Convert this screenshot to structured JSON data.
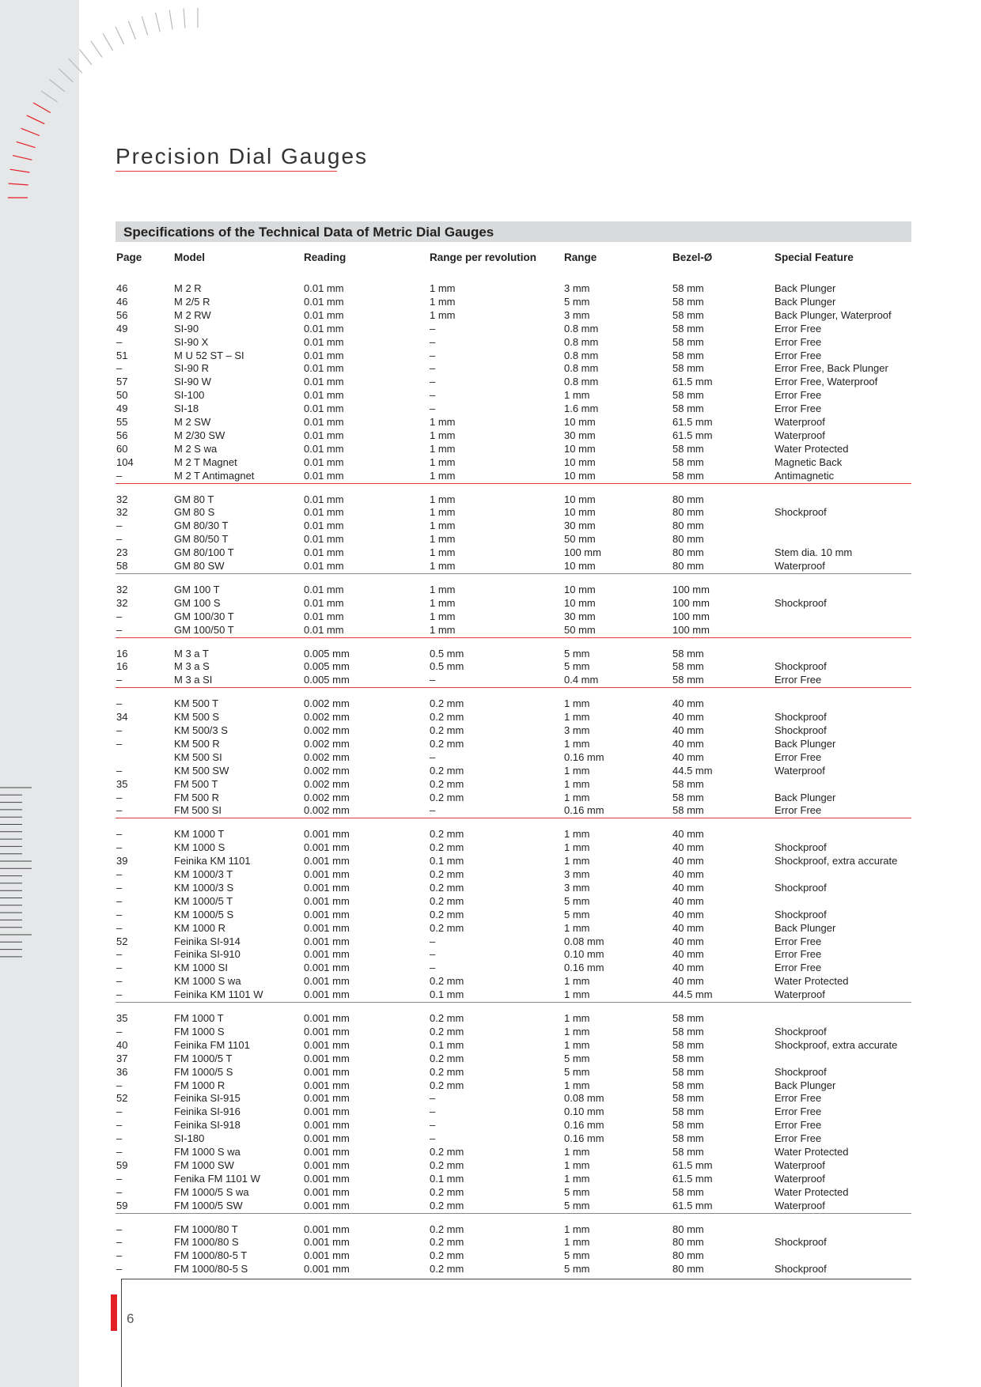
{
  "title": "Precision Dial Gauges",
  "section_title": "Specifications of the Technical Data of Metric Dial Gauges",
  "colors": {
    "accent_red": "#e31e24",
    "header_band": "#d9dadc",
    "left_strip": "#e6e7e9"
  },
  "columns": [
    "Page",
    "Model",
    "Reading",
    "Range per revolution",
    "Range",
    "Bezel-Ø",
    "Special Feature"
  ],
  "groups": [
    {
      "rule": "red",
      "rows": [
        [
          "46",
          "M 2 R",
          "0.01 mm",
          "1 mm",
          "3 mm",
          "58 mm",
          "Back Plunger"
        ],
        [
          "46",
          "M 2/5 R",
          "0.01 mm",
          "1 mm",
          "5 mm",
          "58 mm",
          "Back Plunger"
        ],
        [
          "56",
          "M 2 RW",
          "0.01 mm",
          "1 mm",
          "3 mm",
          "58 mm",
          "Back Plunger, Waterproof"
        ],
        [
          "49",
          "SI-90",
          "0.01 mm",
          "–",
          "0.8 mm",
          "58 mm",
          "Error Free"
        ],
        [
          "–",
          "SI-90 X",
          "0.01 mm",
          "–",
          "0.8 mm",
          "58 mm",
          "Error Free"
        ],
        [
          "51",
          "M U 52 ST – SI",
          "0.01 mm",
          "–",
          "0.8 mm",
          "58 mm",
          "Error Free"
        ],
        [
          "–",
          "SI-90 R",
          "0.01 mm",
          "–",
          "0.8 mm",
          "58 mm",
          "Error Free, Back Plunger"
        ],
        [
          "57",
          "SI-90 W",
          "0.01 mm",
          "–",
          "0.8 mm",
          "61.5 mm",
          "Error Free, Waterproof"
        ],
        [
          "50",
          "SI-100",
          "0.01 mm",
          "–",
          "1 mm",
          "58 mm",
          "Error Free"
        ],
        [
          "49",
          "SI-18",
          "0.01 mm",
          "–",
          "1.6 mm",
          "58 mm",
          "Error Free"
        ],
        [
          "55",
          "M 2 SW",
          "0.01 mm",
          "1 mm",
          "10 mm",
          "61.5 mm",
          "Waterproof"
        ],
        [
          "56",
          "M 2/30 SW",
          "0.01 mm",
          "1 mm",
          "30 mm",
          "61.5 mm",
          "Waterproof"
        ],
        [
          "60",
          "M 2 S wa",
          "0.01 mm",
          "1 mm",
          "10 mm",
          "58 mm",
          "Water Protected"
        ],
        [
          "104",
          "M 2 T Magnet",
          "0.01 mm",
          "1 mm",
          "10 mm",
          "58 mm",
          "Magnetic Back"
        ],
        [
          "–",
          "M 2 T Antimagnet",
          "0.01 mm",
          "1 mm",
          "10 mm",
          "58 mm",
          "Antimagnetic"
        ]
      ]
    },
    {
      "rule": "grey",
      "rows": [
        [
          "32",
          "GM 80 T",
          "0.01 mm",
          "1 mm",
          "10 mm",
          "80 mm",
          ""
        ],
        [
          "32",
          "GM 80 S",
          "0.01 mm",
          "1 mm",
          "10 mm",
          "80 mm",
          "Shockproof"
        ],
        [
          "–",
          "GM 80/30 T",
          "0.01 mm",
          "1 mm",
          "30 mm",
          "80 mm",
          ""
        ],
        [
          "–",
          "GM 80/50 T",
          "0.01 mm",
          "1 mm",
          "50 mm",
          "80 mm",
          ""
        ],
        [
          "23",
          "GM 80/100 T",
          "0.01 mm",
          "1 mm",
          "100 mm",
          "80 mm",
          "Stem dia. 10 mm"
        ],
        [
          "58",
          "GM 80 SW",
          "0.01 mm",
          "1 mm",
          "10 mm",
          "80 mm",
          "Waterproof"
        ]
      ]
    },
    {
      "rule": "red",
      "rows": [
        [
          "32",
          "GM 100 T",
          "0.01 mm",
          "1 mm",
          "10 mm",
          "100 mm",
          ""
        ],
        [
          "32",
          "GM 100 S",
          "0.01 mm",
          "1 mm",
          "10 mm",
          "100 mm",
          "Shockproof"
        ],
        [
          "–",
          "GM 100/30 T",
          "0.01 mm",
          "1 mm",
          "30 mm",
          "100 mm",
          ""
        ],
        [
          "–",
          "GM 100/50 T",
          "0.01 mm",
          "1 mm",
          "50 mm",
          "100 mm",
          ""
        ]
      ]
    },
    {
      "rule": "red",
      "rows": [
        [
          "16",
          "M 3 a T",
          "0.005 mm",
          "0.5 mm",
          "5 mm",
          "58 mm",
          ""
        ],
        [
          "16",
          "M 3 a S",
          "0.005 mm",
          "0.5 mm",
          "5 mm",
          "58 mm",
          "Shockproof"
        ],
        [
          "–",
          "M 3 a SI",
          "0.005 mm",
          "–",
          "0.4 mm",
          "58 mm",
          "Error Free"
        ]
      ]
    },
    {
      "rule": "red",
      "rows": [
        [
          "–",
          "KM 500 T",
          "0.002 mm",
          "0.2 mm",
          "1 mm",
          "40 mm",
          ""
        ],
        [
          "34",
          "KM 500 S",
          "0.002 mm",
          "0.2 mm",
          "1 mm",
          "40 mm",
          "Shockproof"
        ],
        [
          "–",
          "KM 500/3 S",
          "0.002 mm",
          "0.2 mm",
          "3 mm",
          "40 mm",
          "Shockproof"
        ],
        [
          "–",
          "KM 500 R",
          "0.002 mm",
          "0.2 mm",
          "1 mm",
          "40 mm",
          "Back Plunger"
        ],
        [
          "",
          "KM 500 SI",
          "0.002 mm",
          "–",
          "0.16 mm",
          "40 mm",
          "Error Free"
        ],
        [
          "–",
          "KM 500 SW",
          "0.002 mm",
          "0.2 mm",
          "1 mm",
          "44.5 mm",
          "Waterproof"
        ],
        [
          "35",
          "FM 500 T",
          "0.002 mm",
          "0.2 mm",
          "1 mm",
          "58 mm",
          ""
        ],
        [
          "–",
          "FM 500 R",
          "0.002 mm",
          "0.2 mm",
          "1 mm",
          "58 mm",
          "Back Plunger"
        ],
        [
          "–",
          "FM 500 SI",
          "0.002 mm",
          "–",
          "0.16 mm",
          "58 mm",
          "Error Free"
        ]
      ]
    },
    {
      "rule": "grey",
      "rows": [
        [
          "–",
          "KM 1000 T",
          "0.001 mm",
          "0.2 mm",
          "1 mm",
          "40 mm",
          ""
        ],
        [
          "–",
          "KM 1000 S",
          "0.001 mm",
          "0.2 mm",
          "1 mm",
          "40 mm",
          "Shockproof"
        ],
        [
          "39",
          "Feinika KM 1101",
          "0.001 mm",
          "0.1 mm",
          "1 mm",
          "40 mm",
          "Shockproof, extra accurate"
        ],
        [
          "–",
          "KM 1000/3 T",
          "0.001 mm",
          "0.2 mm",
          "3 mm",
          "40 mm",
          ""
        ],
        [
          "–",
          "KM 1000/3 S",
          "0.001 mm",
          "0.2 mm",
          "3 mm",
          "40 mm",
          "Shockproof"
        ],
        [
          "–",
          "KM 1000/5 T",
          "0.001 mm",
          "0.2 mm",
          "5 mm",
          "40 mm",
          ""
        ],
        [
          "–",
          "KM 1000/5 S",
          "0.001 mm",
          "0.2 mm",
          "5 mm",
          "40 mm",
          "Shockproof"
        ],
        [
          "–",
          "KM 1000 R",
          "0.001 mm",
          "0.2 mm",
          "1 mm",
          "40 mm",
          "Back Plunger"
        ],
        [
          "52",
          "Feinika SI-914",
          "0.001 mm",
          "–",
          "0.08 mm",
          "40 mm",
          "Error Free"
        ],
        [
          "–",
          "Feinika SI-910",
          "0.001 mm",
          "–",
          "0.10 mm",
          "40 mm",
          "Error Free"
        ],
        [
          "–",
          "KM 1000 SI",
          "0.001 mm",
          "–",
          "0.16 mm",
          "40 mm",
          "Error Free"
        ],
        [
          "–",
          "KM 1000 S wa",
          "0.001 mm",
          "0.2 mm",
          "1 mm",
          "40 mm",
          "Water Protected"
        ],
        [
          "–",
          "Feinika KM 1101 W",
          "0.001 mm",
          "0.1 mm",
          "1 mm",
          "44.5 mm",
          "Waterproof"
        ]
      ]
    },
    {
      "rule": "grey",
      "rows": [
        [
          "35",
          "FM 1000 T",
          "0.001 mm",
          "0.2 mm",
          "1 mm",
          "58 mm",
          ""
        ],
        [
          "–",
          "FM 1000 S",
          "0.001 mm",
          "0.2 mm",
          "1 mm",
          "58 mm",
          "Shockproof"
        ],
        [
          "40",
          "Feinika FM 1101",
          "0.001 mm",
          "0.1 mm",
          "1 mm",
          "58 mm",
          "Shockproof, extra accurate"
        ],
        [
          "37",
          "FM 1000/5 T",
          "0.001 mm",
          "0.2 mm",
          "5 mm",
          "58 mm",
          ""
        ],
        [
          "36",
          "FM 1000/5 S",
          "0.001 mm",
          "0.2 mm",
          "5 mm",
          "58 mm",
          "Shockproof"
        ],
        [
          "–",
          "FM 1000 R",
          "0.001 mm",
          "0.2 mm",
          "1 mm",
          "58 mm",
          "Back Plunger"
        ],
        [
          "52",
          "Feinika SI-915",
          "0.001 mm",
          "–",
          "0.08 mm",
          "58 mm",
          "Error Free"
        ],
        [
          "–",
          "Feinika SI-916",
          "0.001 mm",
          "–",
          "0.10 mm",
          "58 mm",
          "Error Free"
        ],
        [
          "–",
          "Feinika SI-918",
          "0.001 mm",
          "–",
          "0.16 mm",
          "58 mm",
          "Error Free"
        ],
        [
          "–",
          "SI-180",
          "0.001 mm",
          "–",
          "0.16 mm",
          "58 mm",
          "Error Free"
        ],
        [
          "–",
          "FM 1000 S wa",
          "0.001 mm",
          "0.2 mm",
          "1 mm",
          "58 mm",
          "Water Protected"
        ],
        [
          "59",
          "FM 1000 SW",
          "0.001 mm",
          "0.2 mm",
          "1 mm",
          "61.5 mm",
          "Waterproof"
        ],
        [
          "–",
          "Fenika FM 1101 W",
          "0.001 mm",
          "0.1 mm",
          "1 mm",
          "61.5 mm",
          "Waterproof"
        ],
        [
          "–",
          "FM 1000/5 S wa",
          "0.001 mm",
          "0.2 mm",
          "5 mm",
          "58 mm",
          "Water Protected"
        ],
        [
          "59",
          "FM 1000/5 SW",
          "0.001 mm",
          "0.2 mm",
          "5 mm",
          "61.5 mm",
          "Waterproof"
        ]
      ]
    },
    {
      "rule": "none",
      "rows": [
        [
          "–",
          "FM 1000/80 T",
          "0.001 mm",
          "0.2 mm",
          "1 mm",
          "80 mm",
          ""
        ],
        [
          "–",
          "FM 1000/80 S",
          "0.001 mm",
          "0.2 mm",
          "1 mm",
          "80 mm",
          "Shockproof"
        ],
        [
          "–",
          "FM 1000/80-5 T",
          "0.001 mm",
          "0.2 mm",
          "5 mm",
          "80 mm",
          ""
        ],
        [
          "–",
          "FM 1000/80-5 S",
          "0.001 mm",
          "0.2 mm",
          "5 mm",
          "80 mm",
          "Shockproof"
        ]
      ]
    }
  ],
  "page_number": "6"
}
